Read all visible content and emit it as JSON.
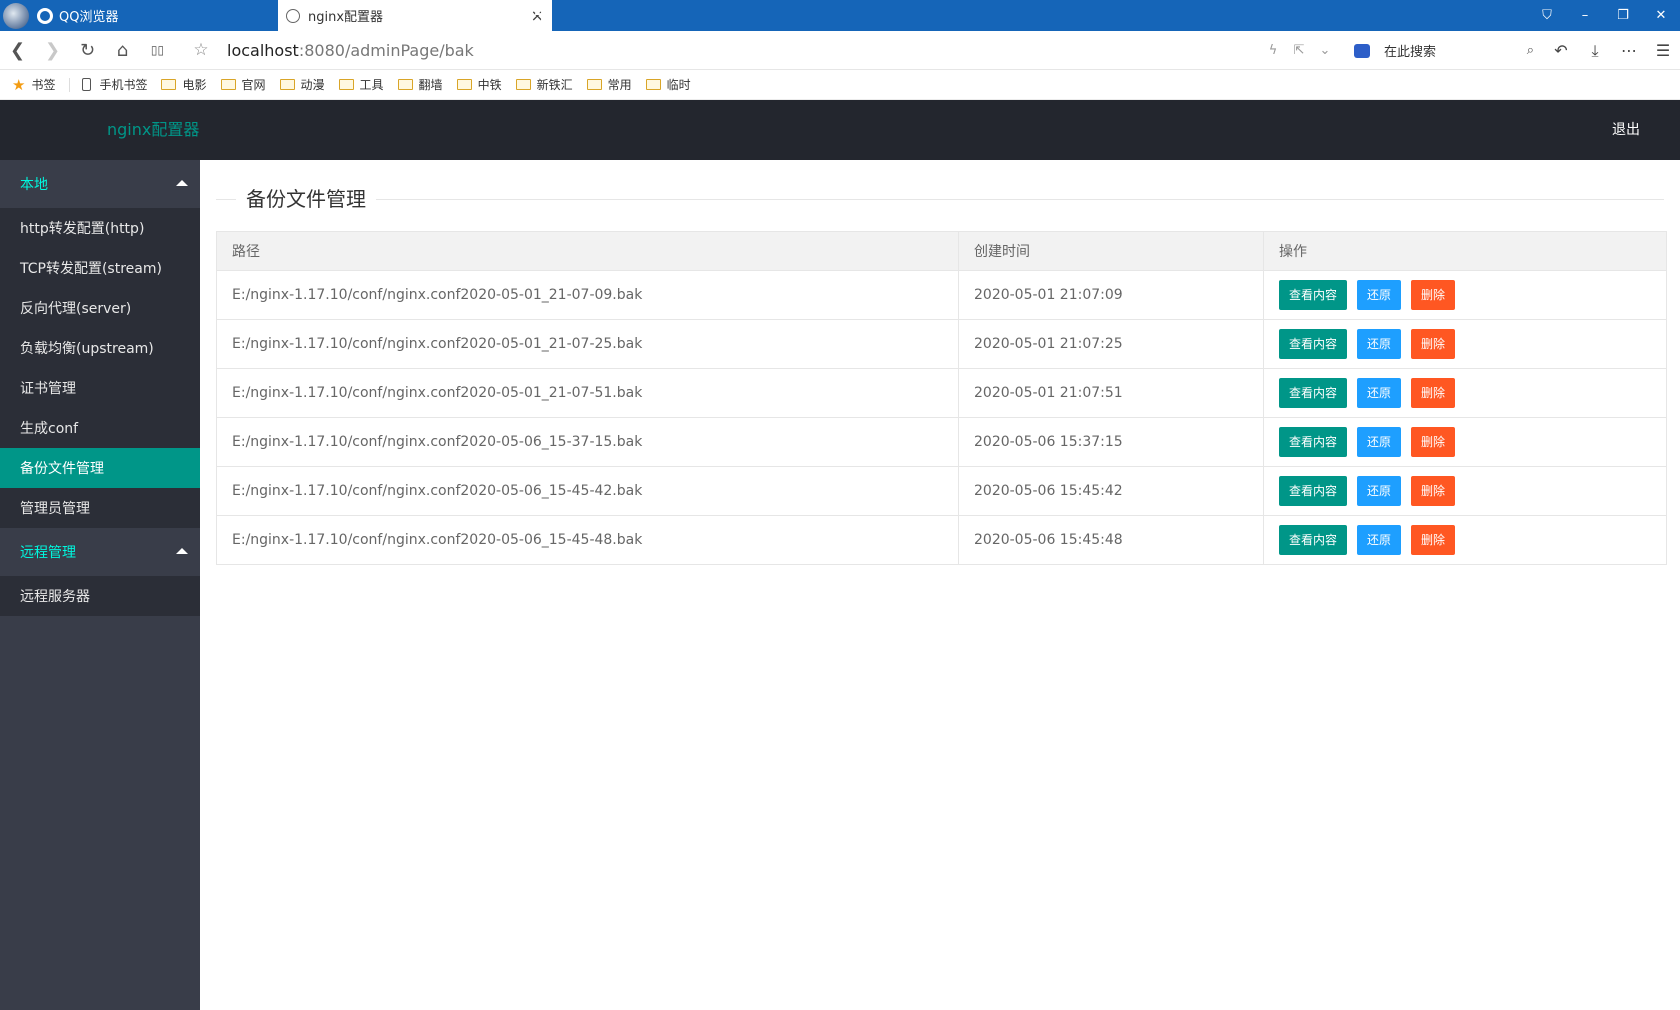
{
  "browser": {
    "app_name": "QQ浏览器",
    "tab_title": "nginx配置器",
    "tab_close": "×",
    "new_tab": "+",
    "url_host": "localhost",
    "url_rest": ":8080/adminPage/bak",
    "search_placeholder": "在此搜索",
    "window_controls": [
      "⛉",
      "–",
      "❐",
      "✕"
    ],
    "nav": {
      "back": "❮",
      "forward": "❯",
      "refresh": "↻",
      "home": "⌂",
      "reader": "▯▯"
    },
    "tools": {
      "undo": "↶",
      "download": "⤓",
      "more": "⋯",
      "menu": "☰"
    }
  },
  "bookmarks": {
    "star_label": "书签",
    "mobile_label": "手机书签",
    "folders": [
      "电影",
      "官网",
      "动漫",
      "工具",
      "翻墙",
      "中铁",
      "新铁汇",
      "常用",
      "临时"
    ]
  },
  "app": {
    "logo": "nginx配置器",
    "logout": "退出"
  },
  "sidebar": {
    "groups": [
      {
        "label": "本地",
        "items": [
          {
            "label": "http转发配置(http)",
            "active": false
          },
          {
            "label": "TCP转发配置(stream)",
            "active": false
          },
          {
            "label": "反向代理(server)",
            "active": false
          },
          {
            "label": "负载均衡(upstream)",
            "active": false
          },
          {
            "label": "证书管理",
            "active": false
          },
          {
            "label": "生成conf",
            "active": false
          },
          {
            "label": "备份文件管理",
            "active": true
          },
          {
            "label": "管理员管理",
            "active": false
          }
        ]
      },
      {
        "label": "远程管理",
        "items": [
          {
            "label": "远程服务器",
            "active": false
          }
        ]
      }
    ]
  },
  "main": {
    "title": "备份文件管理",
    "table": {
      "headers": [
        "路径",
        "创建时间",
        "操作"
      ],
      "actions": {
        "view": "查看内容",
        "restore": "还原",
        "delete": "删除"
      },
      "rows": [
        {
          "path": "E:/nginx-1.17.10/conf/nginx.conf2020-05-01_21-07-09.bak",
          "time": "2020-05-01 21:07:09"
        },
        {
          "path": "E:/nginx-1.17.10/conf/nginx.conf2020-05-01_21-07-25.bak",
          "time": "2020-05-01 21:07:25"
        },
        {
          "path": "E:/nginx-1.17.10/conf/nginx.conf2020-05-01_21-07-51.bak",
          "time": "2020-05-01 21:07:51"
        },
        {
          "path": "E:/nginx-1.17.10/conf/nginx.conf2020-05-06_15-37-15.bak",
          "time": "2020-05-06 15:37:15"
        },
        {
          "path": "E:/nginx-1.17.10/conf/nginx.conf2020-05-06_15-45-42.bak",
          "time": "2020-05-06 15:45:42"
        },
        {
          "path": "E:/nginx-1.17.10/conf/nginx.conf2020-05-06_15-45-48.bak",
          "time": "2020-05-06 15:45:48"
        }
      ]
    }
  },
  "colors": {
    "tabbar": "#1565b8",
    "header": "#23262e",
    "sidebar": "#393d49",
    "accent": "#009688",
    "restore": "#1e9fff",
    "delete": "#ff5722"
  }
}
